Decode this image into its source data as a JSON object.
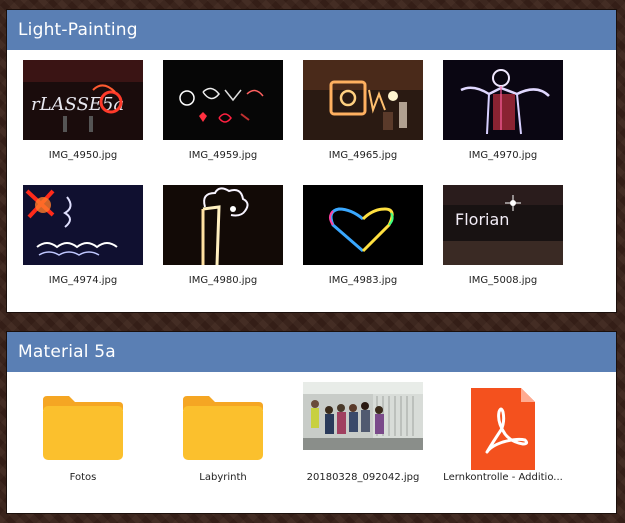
{
  "sections": [
    {
      "title": "Light-Painting",
      "items": [
        {
          "name": "IMG_4950.jpg",
          "thumb_text": "rLASSE5a"
        },
        {
          "name": "IMG_4959.jpg",
          "thumb_text": ""
        },
        {
          "name": "IMG_4965.jpg",
          "thumb_text": ""
        },
        {
          "name": "IMG_4970.jpg",
          "thumb_text": ""
        },
        {
          "name": "IMG_4974.jpg",
          "thumb_text": ""
        },
        {
          "name": "IMG_4980.jpg",
          "thumb_text": ""
        },
        {
          "name": "IMG_4983.jpg",
          "thumb_text": ""
        },
        {
          "name": "IMG_5008.jpg",
          "thumb_text": "Florian"
        }
      ]
    },
    {
      "title": "Material 5a",
      "items": [
        {
          "name": "Fotos",
          "kind": "folder"
        },
        {
          "name": "Labyrinth",
          "kind": "folder"
        },
        {
          "name": "20180328_092042.jpg",
          "kind": "image"
        },
        {
          "name": "Lernkontrolle - Additio...",
          "kind": "pdf"
        }
      ]
    }
  ],
  "colors": {
    "header": "#5a7fb4",
    "folder": "#fbc02d",
    "folder_tab": "#f5a623",
    "pdf": "#f4511e"
  },
  "icons": [
    "folder-icon",
    "pdf-icon"
  ]
}
